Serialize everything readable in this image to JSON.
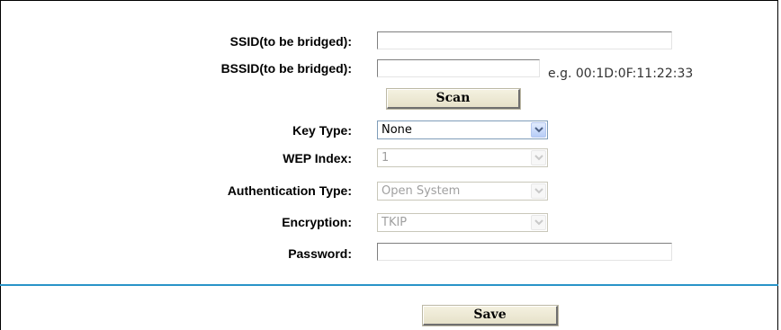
{
  "form": {
    "ssid_label": "SSID(to be bridged):",
    "ssid_value": "",
    "bssid_label": "BSSID(to be bridged):",
    "bssid_value": "",
    "bssid_hint": "e.g. 00:1D:0F:11:22:33",
    "scan_label": "Scan",
    "key_type_label": "Key Type:",
    "key_type_value": "None",
    "wep_index_label": "WEP Index:",
    "wep_index_value": "1",
    "auth_type_label": "Authentication Type:",
    "auth_type_value": "Open System",
    "encryption_label": "Encryption:",
    "encryption_value": "TKIP",
    "password_label": "Password:",
    "password_value": "",
    "save_label": "Save"
  },
  "icons": {
    "dropdown_arrow": "chevron-down-icon"
  },
  "colors": {
    "separator": "#2994c8",
    "select_border": "#7f9db9",
    "disabled_text": "#a0a0a0"
  }
}
